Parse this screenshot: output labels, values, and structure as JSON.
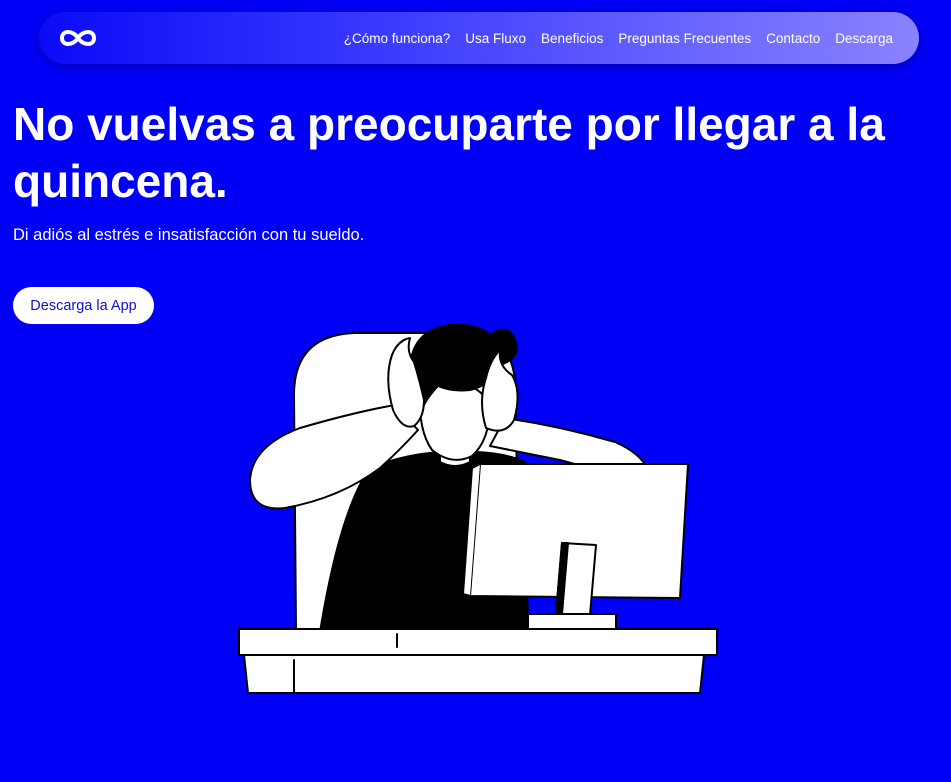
{
  "nav": {
    "logo_icon": "infinity-icon",
    "links": [
      {
        "label": "¿Cómo funciona?"
      },
      {
        "label": "Usa Fluxo"
      },
      {
        "label": "Beneficios"
      },
      {
        "label": "Preguntas Frecuentes"
      },
      {
        "label": "Contacto"
      },
      {
        "label": "Descarga"
      }
    ]
  },
  "hero": {
    "title": "No vuelvas a preocuparte por llegar a la quincena.",
    "subtitle": "Di adiós al estrés e insatisfacción con tu sueldo.",
    "cta_label": "Descarga la App",
    "illustration_icon": "stressed-person-at-computer-illustration"
  },
  "colors": {
    "background": "#0000f6",
    "navbar_gradient_end": "#8a82ff",
    "button_bg": "#ffffff",
    "button_text": "#1010d0"
  }
}
